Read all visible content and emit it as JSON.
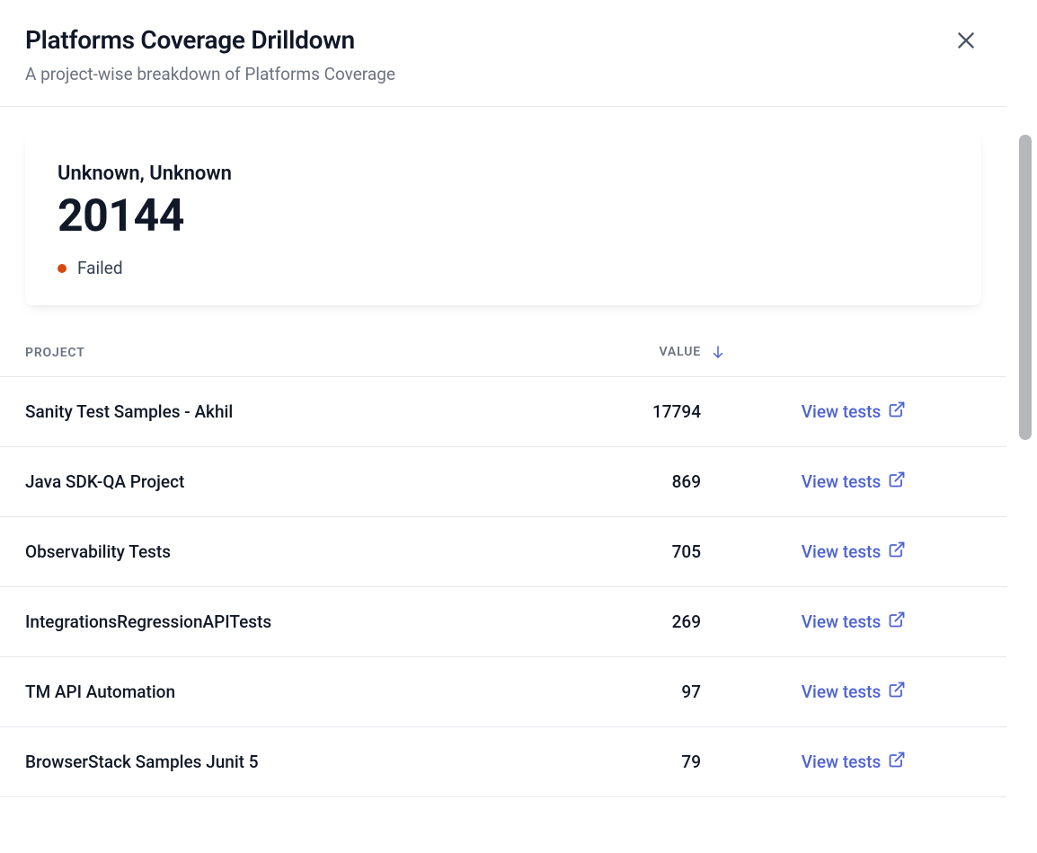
{
  "header": {
    "title": "Platforms Coverage Drilldown",
    "subtitle": "A project-wise breakdown of Platforms Coverage"
  },
  "summary": {
    "subtitle": "Unknown, Unknown",
    "count": "20144",
    "status_label": "Failed",
    "status_color": "#d9480f"
  },
  "table": {
    "headers": {
      "project": "PROJECT",
      "value": "VALUE"
    },
    "action_label": "View tests",
    "rows": [
      {
        "project": "Sanity Test Samples - Akhil",
        "value": "17794"
      },
      {
        "project": "Java SDK-QA Project",
        "value": "869"
      },
      {
        "project": "Observability Tests",
        "value": "705"
      },
      {
        "project": "IntegrationsRegressionAPITests",
        "value": "269"
      },
      {
        "project": "TM API Automation",
        "value": "97"
      },
      {
        "project": "BrowserStack Samples Junit 5",
        "value": "79"
      }
    ]
  }
}
